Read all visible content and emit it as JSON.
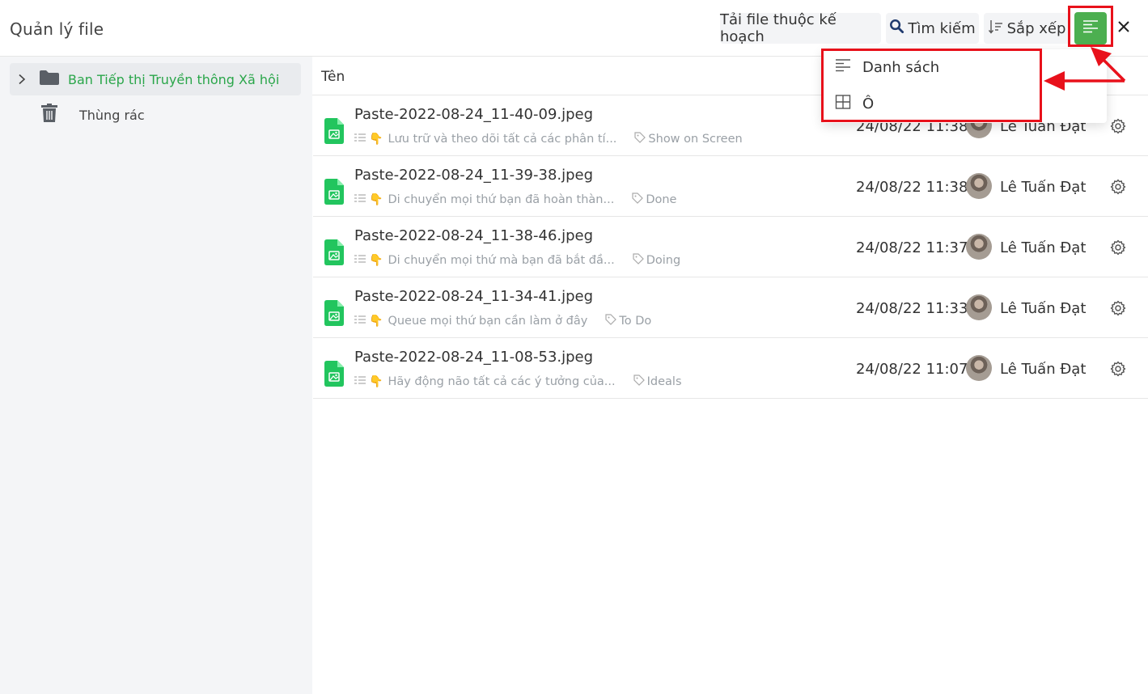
{
  "header": {
    "title": "Quản lý file",
    "upload_label": "Tải file thuộc kế hoạch",
    "search_label": "Tìm kiếm",
    "sort_label": "Sắp xếp"
  },
  "sidebar": {
    "folder_label": "Ban Tiếp thị Truyền thông Xã hội",
    "trash_label": "Thùng rác"
  },
  "list": {
    "column_name": "Tên",
    "rows": [
      {
        "name": "Paste-2022-08-24_11-40-09.jpeg",
        "desc": "Lưu trữ và theo dõi tất cả các phân tí...",
        "tag": "Show on Screen",
        "date": "24/08/22 11:38",
        "user": "Lê Tuấn Đạt"
      },
      {
        "name": "Paste-2022-08-24_11-39-38.jpeg",
        "desc": "Di chuyển mọi thứ bạn đã hoàn thàn...",
        "tag": "Done",
        "date": "24/08/22 11:38",
        "user": "Lê Tuấn Đạt"
      },
      {
        "name": "Paste-2022-08-24_11-38-46.jpeg",
        "desc": "Di chuyển mọi thứ mà bạn đã bắt đầ...",
        "tag": "Doing",
        "date": "24/08/22 11:37",
        "user": "Lê Tuấn Đạt"
      },
      {
        "name": "Paste-2022-08-24_11-34-41.jpeg",
        "desc": "Queue mọi thứ bạn cần làm ở đây",
        "tag": "To Do",
        "date": "24/08/22 11:33",
        "user": "Lê Tuấn Đạt"
      },
      {
        "name": "Paste-2022-08-24_11-08-53.jpeg",
        "desc": "Hãy động não tất cả các ý tưởng của...",
        "tag": "Ideals",
        "date": "24/08/22 11:07",
        "user": "Lê Tuấn Đạt"
      }
    ]
  },
  "view_menu": {
    "list_label": "Danh sách",
    "grid_label": "Ô"
  },
  "icons": {
    "view_button": "list-view-icon",
    "close": "close-icon",
    "file": "image-file-icon",
    "folder": "folder-icon",
    "trash": "trash-icon",
    "row_action": "gear-icon"
  },
  "colors": {
    "accent_green": "#4caf50",
    "folder_label": "#2aa64a",
    "highlight_red": "#e8111b"
  }
}
